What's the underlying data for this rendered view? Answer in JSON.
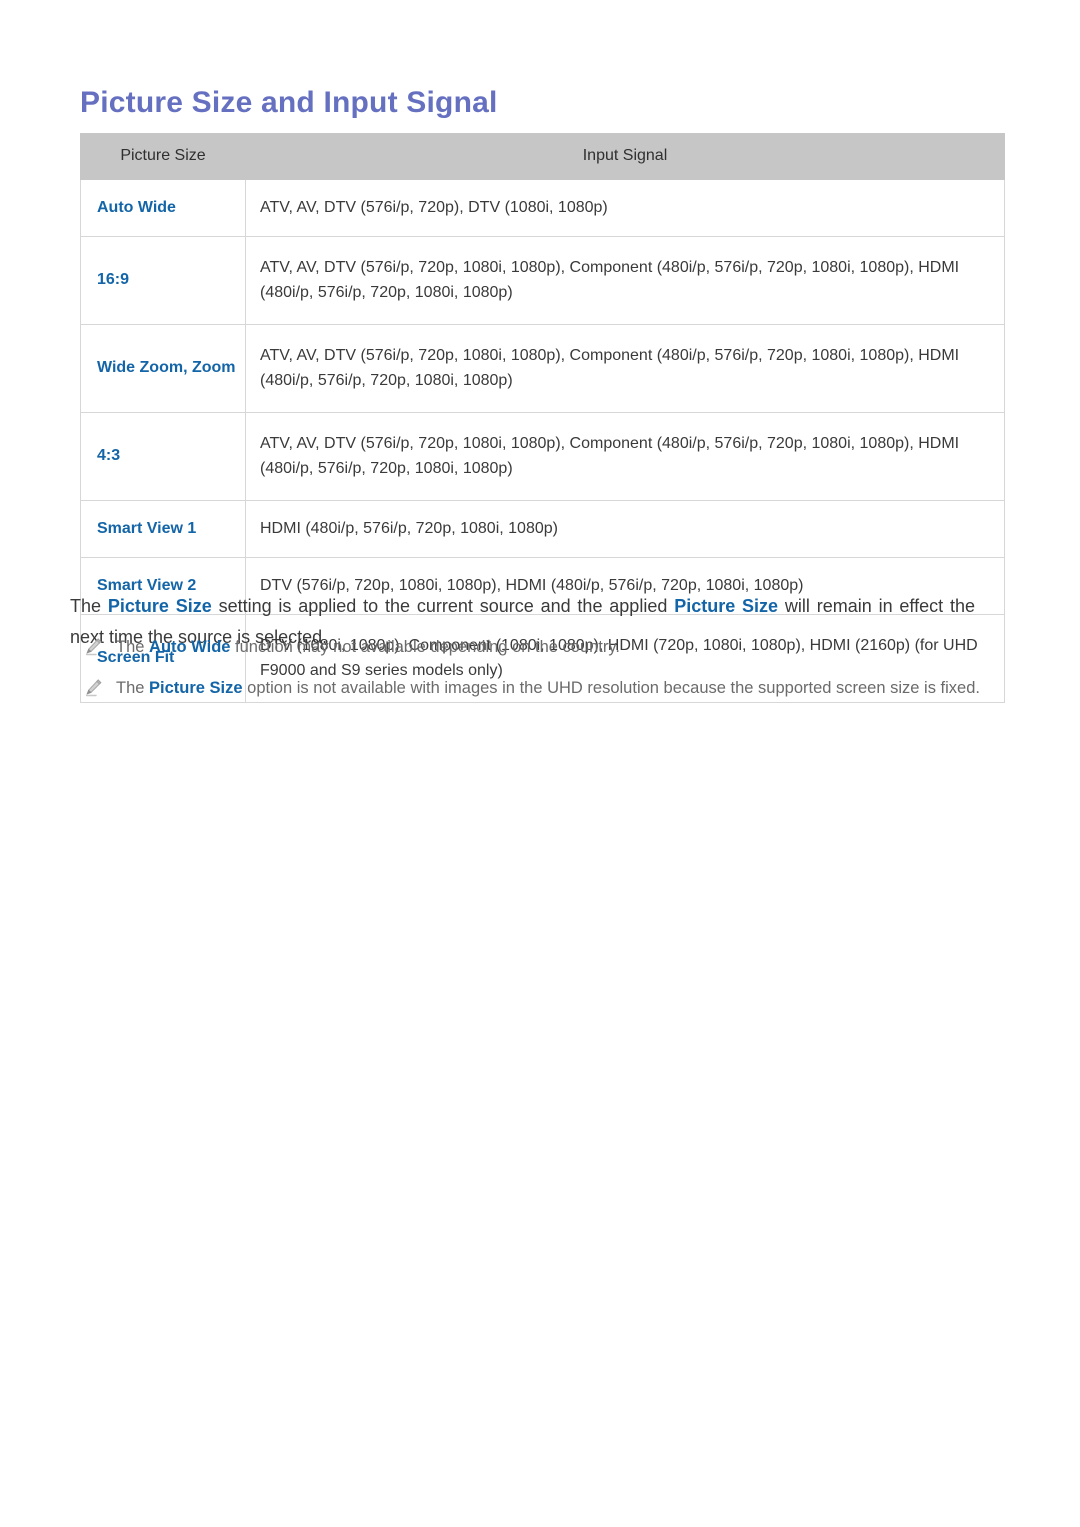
{
  "document": {
    "title": "Picture Size and Input Signal"
  },
  "table": {
    "headers": [
      "Picture Size",
      "Input Signal"
    ],
    "rows": [
      {
        "size": "Auto Wide",
        "input": "ATV, AV, DTV (576i/p, 720p), DTV (1080i, 1080p)",
        "height": "short"
      },
      {
        "size": "16:9",
        "input": "ATV, AV, DTV (576i/p, 720p, 1080i, 1080p), Component (480i/p, 576i/p, 720p, 1080i, 1080p), HDMI (480i/p, 576i/p, 720p, 1080i, 1080p)",
        "height": "tall"
      },
      {
        "size": "Wide Zoom, Zoom",
        "input": "ATV, AV, DTV (576i/p, 720p, 1080i, 1080p), Component (480i/p, 576i/p, 720p, 1080i, 1080p), HDMI (480i/p, 576i/p, 720p, 1080i, 1080p)",
        "height": "tall"
      },
      {
        "size": "4:3",
        "input": "ATV, AV, DTV (576i/p, 720p, 1080i, 1080p), Component (480i/p, 576i/p, 720p, 1080i, 1080p), HDMI (480i/p, 576i/p, 720p, 1080i, 1080p)",
        "height": "tall"
      },
      {
        "size": "Smart View 1",
        "input": "HDMI (480i/p, 576i/p, 720p, 1080i, 1080p)",
        "height": "short"
      },
      {
        "size": "Smart View 2",
        "input": "DTV (576i/p, 720p, 1080i, 1080p), HDMI (480i/p, 576i/p, 720p, 1080i, 1080p)",
        "height": "short"
      },
      {
        "size": "Screen Fit",
        "input": "DTV (1080i, 1080p), Component (1080i, 1080p), HDMI (720p, 1080i, 1080p), HDMI (2160p) (for UHD F9000 and S9 series models only)",
        "height": "tall"
      }
    ]
  },
  "paragraph": {
    "part1": "The ",
    "link1": "Picture Size",
    "part2": " setting is applied to the current source and the applied ",
    "link2": "Picture Size",
    "part3": " will remain in effect the next time the source is selected."
  },
  "notes": [
    {
      "icon": "pencil-icon",
      "part1": "The ",
      "link": "Auto Wide",
      "part2": " function may not available depending on the country."
    },
    {
      "icon": "pencil-icon",
      "part1": "The ",
      "link": "Picture Size",
      "part2": " option is not available with images in the UHD resolution because the supported screen size is fixed."
    }
  ],
  "colors": {
    "title": "#6670c0",
    "link": "#1365a8",
    "header_bg": "#c6c6c6",
    "border": "#d7d7d7",
    "body_text": "#3a3a3a",
    "note_text": "#6b6b6b"
  }
}
